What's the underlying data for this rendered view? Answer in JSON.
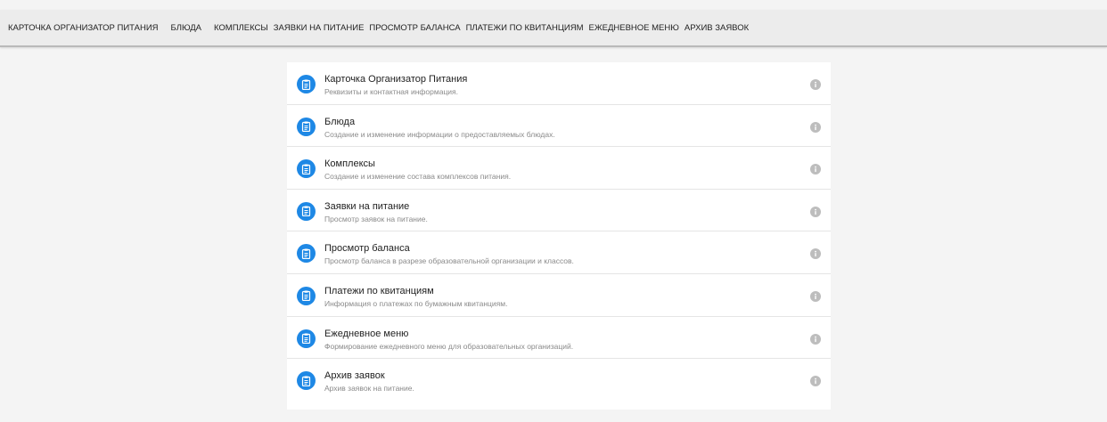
{
  "nav": {
    "items": [
      "КАРТОЧКА ОРГАНИЗАТОР ПИТАНИЯ",
      "БЛЮДА",
      "КОМПЛЕКСЫ",
      "ЗАЯВКИ НА ПИТАНИЕ",
      "ПРОСМОТР БАЛАНСА",
      "ПЛАТЕЖИ ПО КВИТАНЦИЯМ",
      "ЕЖЕДНЕВНОЕ МЕНЮ",
      "АРХИВ ЗАЯВОК"
    ]
  },
  "list": {
    "items": [
      {
        "title": "Карточка Организатор Питания",
        "description": "Реквизиты и контактная информация.",
        "icon": "clipboard-icon"
      },
      {
        "title": "Блюда",
        "description": "Создание и изменение информации о предоставляемых блюдах.",
        "icon": "clipboard-icon"
      },
      {
        "title": "Комплексы",
        "description": "Создание и изменение состава комплексов питания.",
        "icon": "clipboard-icon"
      },
      {
        "title": "Заявки на питание",
        "description": "Просмотр заявок на питание.",
        "icon": "clipboard-icon"
      },
      {
        "title": "Просмотр баланса",
        "description": "Просмотр баланса в разрезе образовательной организации и классов.",
        "icon": "clipboard-icon"
      },
      {
        "title": "Платежи по квитанциям",
        "description": "Информация о платежах по бумажным квитанциям.",
        "icon": "clipboard-icon"
      },
      {
        "title": "Ежедневное меню",
        "description": "Формирование ежедневного меню для образовательных организаций.",
        "icon": "clipboard-icon"
      },
      {
        "title": "Архив заявок",
        "description": "Архив заявок на питание.",
        "icon": "clipboard-icon"
      }
    ]
  },
  "colors": {
    "accent": "#1e88e5",
    "info_icon": "#bdbdbd",
    "background": "#f4f4f4",
    "topbar": "#ececec"
  }
}
